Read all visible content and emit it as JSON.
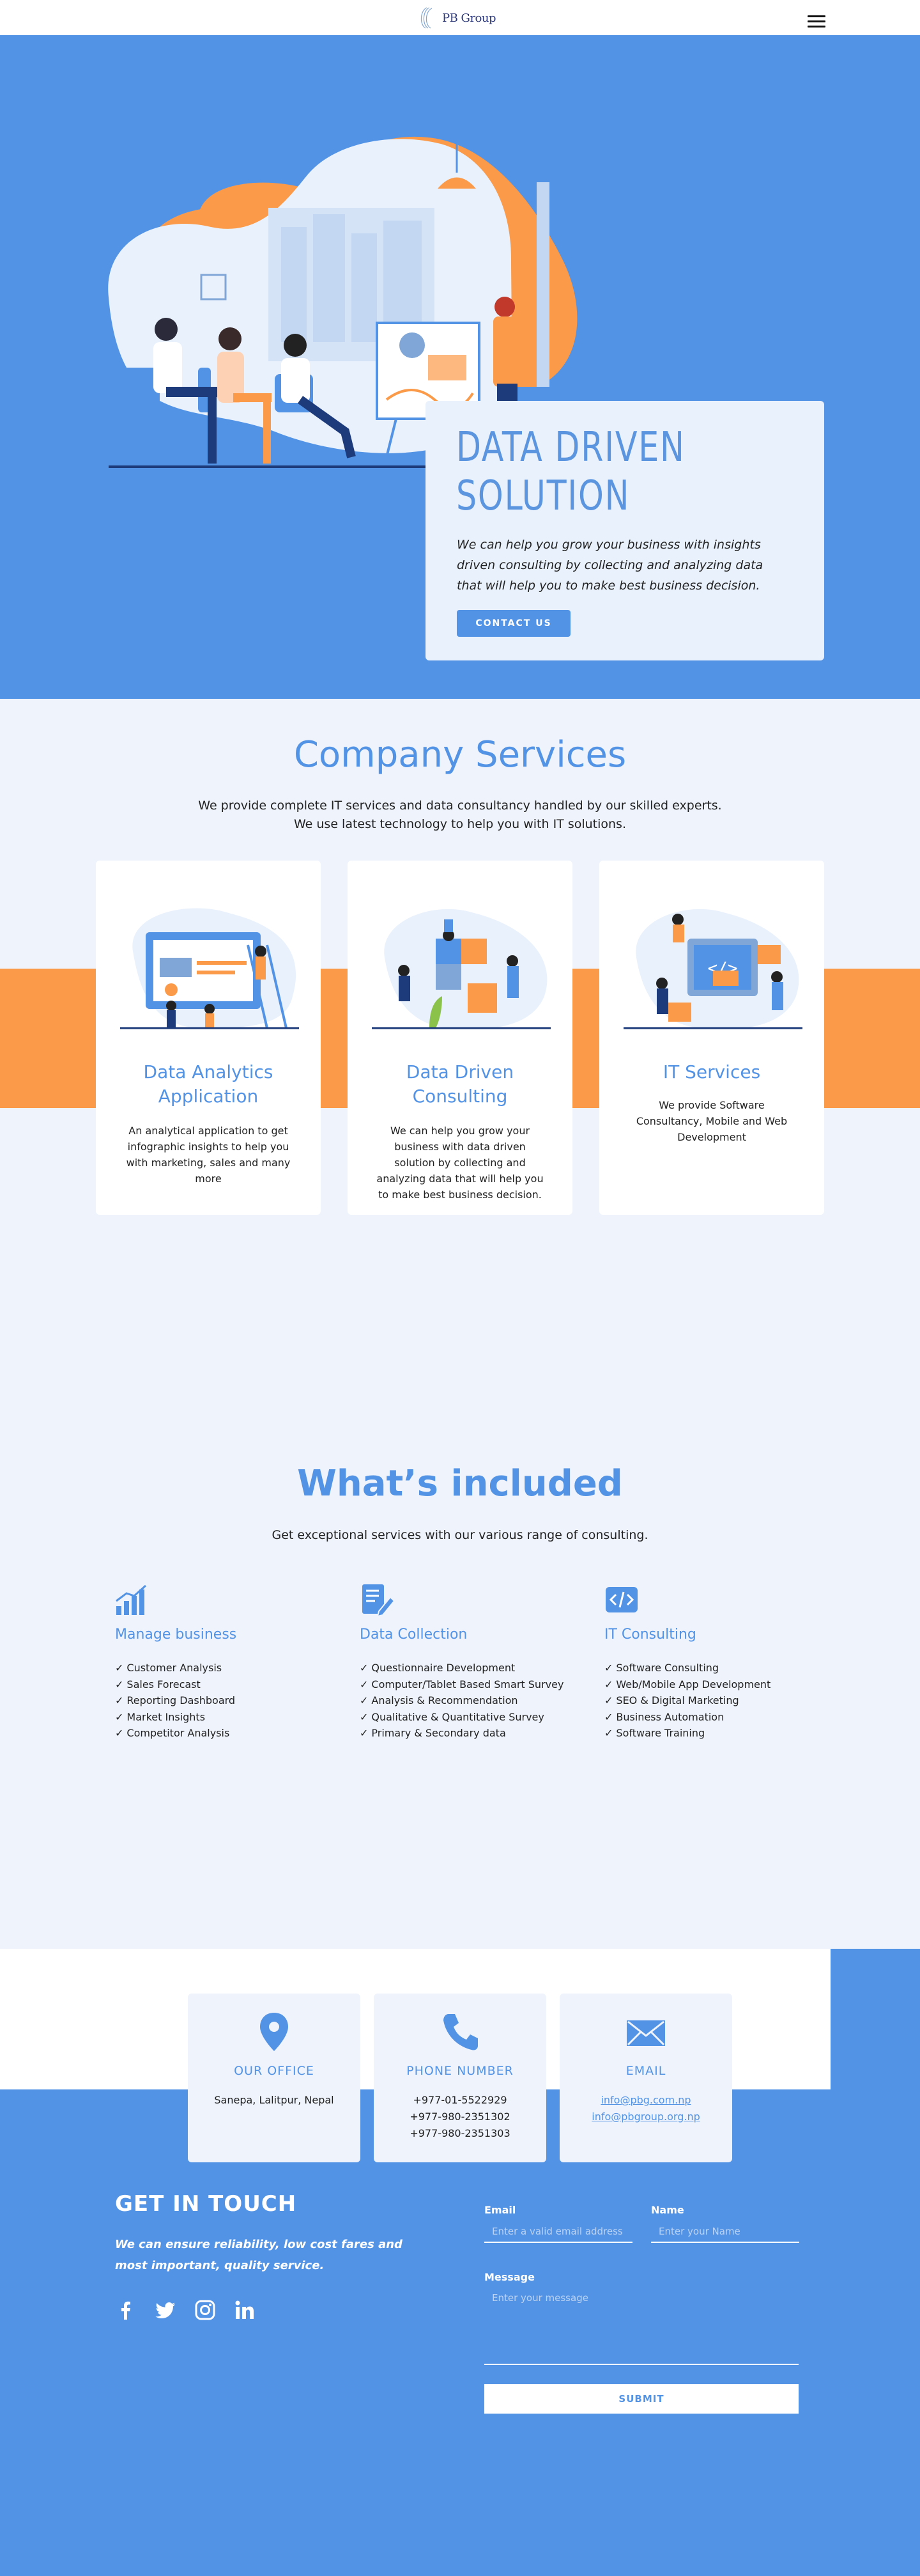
{
  "header": {
    "logo_text": "PB Group"
  },
  "hero": {
    "title": "DATA DRIVEN SOLUTION",
    "text": "We can help you grow your business with insights driven consulting by collecting and analyzing data that will help you to make best business decision.",
    "button": "CONTACT US"
  },
  "services": {
    "title": "Company Services",
    "subtitle_1": "We provide complete IT services and data consultancy handled by our skilled experts.",
    "subtitle_2": "We use latest technology to help you with IT solutions.",
    "cards": [
      {
        "title": "Data Analytics Application",
        "text": "An analytical application to get infographic insights to help you with marketing, sales and many more"
      },
      {
        "title": "Data Driven Consulting",
        "text": "We can help you grow your business with data driven solution by collecting and analyzing data that will help you to make best business decision."
      },
      {
        "title": "IT Services",
        "text": "We provide Software Consultancy, Mobile and Web Development"
      }
    ]
  },
  "included": {
    "title": "What’s included",
    "subtitle": "Get exceptional services with our various range of consulting.",
    "columns": [
      {
        "title": "Manage business",
        "icon": "bar-chart-icon",
        "items": [
          "Customer Analysis",
          "Sales Forecast",
          "Reporting Dashboard",
          "Market Insights",
          "Competitor Analysis"
        ]
      },
      {
        "title": "Data Collection",
        "icon": "document-edit-icon",
        "items": [
          "Questionnaire Development",
          "Computer/Tablet Based Smart Survey",
          "Analysis & Recommendation",
          "Qualitative & Quantitative Survey",
          "Primary & Secondary data"
        ]
      },
      {
        "title": "IT Consulting",
        "icon": "code-icon",
        "items": [
          "Software Consulting",
          "Web/Mobile App Development",
          "SEO & Digital Marketing",
          "Business Automation",
          "Software Training"
        ]
      }
    ]
  },
  "contact_cards": [
    {
      "title": "OUR OFFICE",
      "icon": "location-pin-icon",
      "lines": [
        "Sanepa, Lalitpur, Nepal"
      ]
    },
    {
      "title": "PHONE NUMBER",
      "icon": "phone-icon",
      "lines": [
        "+977-01-5522929",
        "+977-980-2351302",
        "+977-980-2351303"
      ]
    },
    {
      "title": "EMAIL",
      "icon": "envelope-icon",
      "lines": [
        "info@pbg.com.np",
        "info@pbgroup.org.np"
      ]
    }
  ],
  "get_in_touch": {
    "title": "GET IN TOUCH",
    "text": "We can ensure reliability, low cost fares and most important, quality service.",
    "form": {
      "email_label": "Email",
      "email_placeholder": "Enter a valid email address",
      "name_label": "Name",
      "name_placeholder": "Enter your Name",
      "message_label": "Message",
      "message_placeholder": "Enter your message",
      "submit": "SUBMIT"
    }
  },
  "colors": {
    "primary": "#5393e5",
    "accent": "#fb9a48",
    "light_bg": "#eef3fc"
  }
}
